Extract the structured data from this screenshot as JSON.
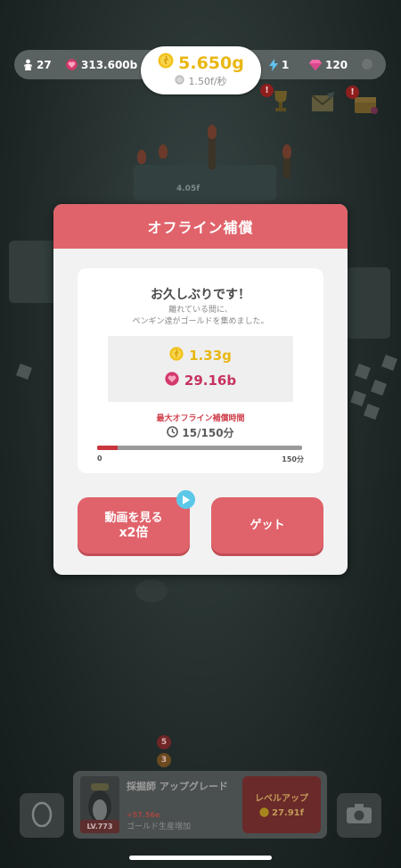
{
  "top_bar": {
    "penguins": "27",
    "hearts": "313.600b",
    "gold": "5.650g",
    "gold_rate": "1.50f/秒",
    "energy": "1",
    "gems": "120"
  },
  "background": {
    "station_value": "4.05f"
  },
  "modal": {
    "title": "オフライン補償",
    "greeting": "お久しぶりです！",
    "message_line1": "離れている間に、",
    "message_line2": "ペンギン達がゴールドを集めました。",
    "reward_gold": "1.33g",
    "reward_hearts": "29.16b",
    "max_label": "最大オフライン補償時間",
    "time_text": "15/150分",
    "progress": 0.1,
    "progress_min": "0",
    "progress_max": "150分",
    "video_button_line1": "動画を見る",
    "video_button_line2": "x2倍",
    "get_button": "ゲット"
  },
  "bottom": {
    "upgrade_title": "採掘師 アップグレード",
    "upgrade_value": "+57.56e",
    "upgrade_desc": "ゴールド生産増加",
    "level": "LV.773",
    "levelup_label": "レベルアップ",
    "levelup_cost": "27.91f",
    "badge_top": "5",
    "badge_bottom": "3"
  },
  "alerts": "!",
  "colors": {
    "accent": "#e0636b",
    "gold": "#e9b714",
    "heart": "#c6325e",
    "progress": "#c9343e",
    "play": "#5cc8e8"
  },
  "icons": [
    "penguin-icon",
    "heart-icon",
    "gold-coin-icon",
    "clock-icon",
    "lightning-icon",
    "gem-icon",
    "trophy-icon",
    "mail-icon",
    "treasure-icon",
    "play-icon",
    "egg-icon",
    "camera-icon"
  ]
}
